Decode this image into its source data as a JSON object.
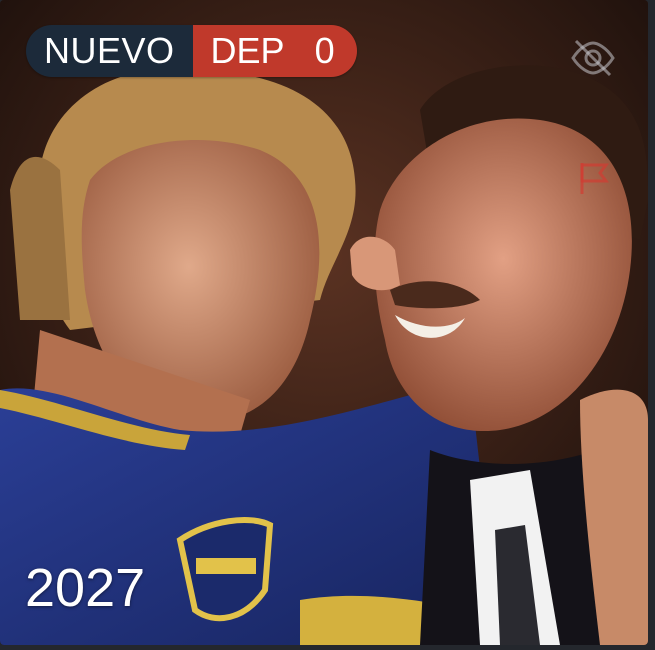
{
  "badge": {
    "status": "NUEVO",
    "category": "DEP",
    "count": "0"
  },
  "year": "2027",
  "icons": {
    "hide": "eye-slash-icon",
    "report": "flag-icon"
  },
  "colors": {
    "status_bg": "#1c2a3a",
    "category_bg": "#c0392b"
  }
}
